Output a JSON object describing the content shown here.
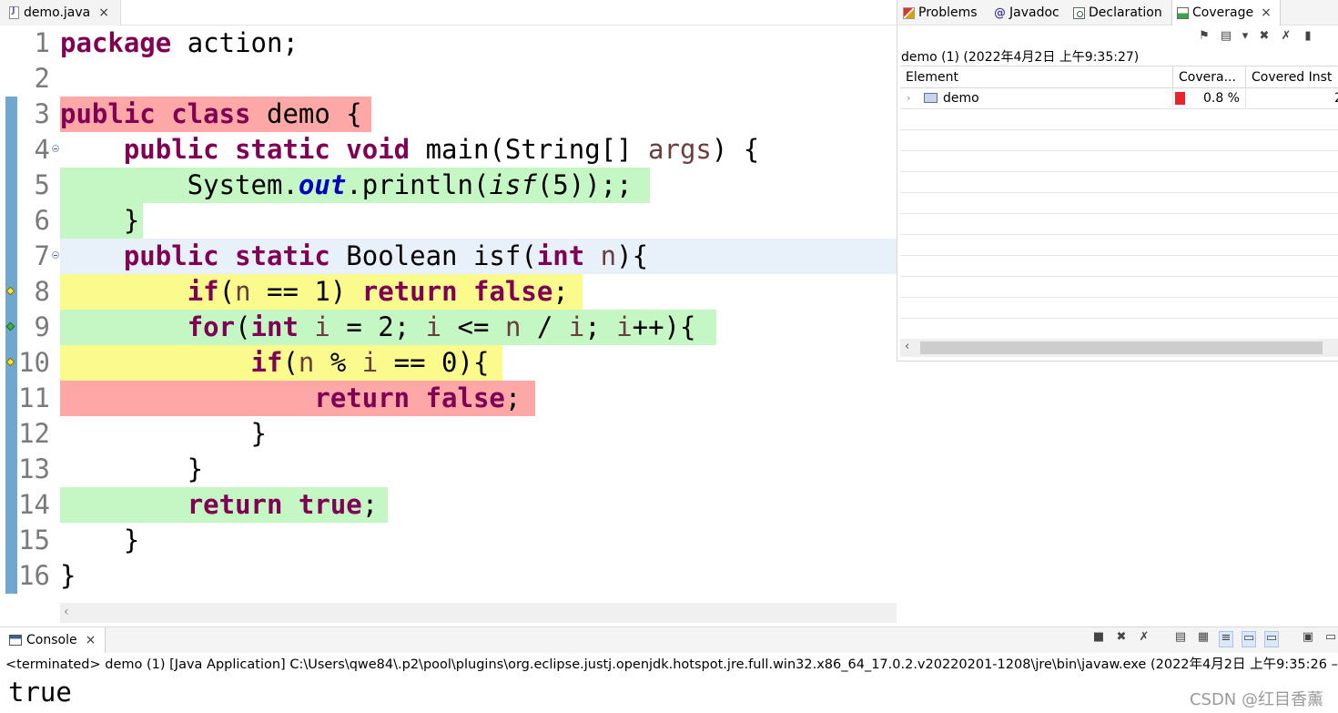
{
  "editor": {
    "tab": {
      "label": "demo.java",
      "close": "×"
    },
    "lines": [
      {
        "n": "1",
        "tokens": [
          [
            "kw",
            "package"
          ],
          [
            "",
            "action;"
          ]
        ]
      },
      {
        "n": "2",
        "tokens": []
      },
      {
        "n": "3",
        "tokens": [
          [
            "kw",
            "public"
          ],
          [
            "kw",
            "class"
          ],
          [
            "",
            "demo {"
          ]
        ]
      },
      {
        "n": "4",
        "tokens": [
          [
            "",
            "    "
          ],
          [
            "kw",
            "public"
          ],
          [
            "kw",
            "static"
          ],
          [
            "kw",
            "void"
          ],
          [
            "",
            "main(String[] "
          ],
          [
            "var",
            "args"
          ],
          [
            "",
            ") {"
          ]
        ]
      },
      {
        "n": "5",
        "tokens": [
          [
            "",
            "        System."
          ],
          [
            "field",
            "out"
          ],
          [
            "",
            ".println("
          ],
          [
            "italic",
            "isf"
          ],
          [
            "",
            "(5));;"
          ]
        ]
      },
      {
        "n": "6",
        "tokens": [
          [
            "",
            "    }"
          ]
        ]
      },
      {
        "n": "7",
        "tokens": [
          [
            "",
            "    "
          ],
          [
            "kw",
            "public"
          ],
          [
            "kw",
            "static"
          ],
          [
            "",
            "Boolean isf("
          ],
          [
            "kw",
            "int"
          ],
          [
            "var",
            "n"
          ],
          [
            "",
            "){"
          ]
        ]
      },
      {
        "n": "8",
        "tokens": [
          [
            "",
            "        "
          ],
          [
            "kw",
            "if"
          ],
          [
            "",
            "("
          ],
          [
            "var",
            "n"
          ],
          [
            "",
            "== 1) "
          ],
          [
            "kw",
            "return"
          ],
          [
            "kw",
            "false"
          ],
          [
            "",
            ";"
          ]
        ]
      },
      {
        "n": "9",
        "tokens": [
          [
            "",
            "        "
          ],
          [
            "kw",
            "for"
          ],
          [
            "",
            "("
          ],
          [
            "kw",
            "int"
          ],
          [
            "var",
            "i"
          ],
          [
            "",
            "= 2; "
          ],
          [
            "var",
            "i"
          ],
          [
            "",
            "<= "
          ],
          [
            "var",
            "n"
          ],
          [
            "",
            "/ "
          ],
          [
            "var",
            "i"
          ],
          [
            "",
            "; "
          ],
          [
            "var",
            "i"
          ],
          [
            "",
            "++){"
          ]
        ]
      },
      {
        "n": "10",
        "tokens": [
          [
            "",
            "            "
          ],
          [
            "kw",
            "if"
          ],
          [
            "",
            "("
          ],
          [
            "var",
            "n"
          ],
          [
            "",
            "% "
          ],
          [
            "var",
            "i"
          ],
          [
            "",
            "== 0){"
          ]
        ]
      },
      {
        "n": "11",
        "tokens": [
          [
            "",
            "                "
          ],
          [
            "kw",
            "return"
          ],
          [
            "kw",
            "false"
          ],
          [
            "",
            ";"
          ]
        ]
      },
      {
        "n": "12",
        "tokens": [
          [
            "",
            "            }"
          ]
        ]
      },
      {
        "n": "13",
        "tokens": [
          [
            "",
            "        }"
          ]
        ]
      },
      {
        "n": "14",
        "tokens": [
          [
            "",
            "        "
          ],
          [
            "kw",
            "return"
          ],
          [
            "kw",
            "true"
          ],
          [
            "",
            ";"
          ]
        ]
      },
      {
        "n": "15",
        "tokens": [
          [
            "",
            "    }"
          ]
        ]
      },
      {
        "n": "16",
        "tokens": [
          [
            "",
            "}"
          ]
        ]
      }
    ]
  },
  "coverage_panel": {
    "tabs": [
      {
        "label": "Problems",
        "icon": "problems-icon"
      },
      {
        "label": "Javadoc",
        "icon": "javadoc-icon"
      },
      {
        "label": "Declaration",
        "icon": "declaration-icon"
      },
      {
        "label": "Coverage",
        "icon": "coverage-icon",
        "active": true,
        "close": "×"
      }
    ],
    "session": "demo (1) (2022年4月2日 上午9:35:27)",
    "columns": [
      "Element",
      "Covera...",
      "Covered Inst"
    ],
    "rows": [
      {
        "chevron": "›",
        "element": "demo",
        "coverage": "0.8 %",
        "covered": "2"
      }
    ],
    "colors": {
      "coverage_bar": "#e9252b"
    }
  },
  "console": {
    "tab_label": "Console",
    "close": "×",
    "status": "<terminated> demo (1) [Java Application] C:\\Users\\qwe84\\.p2\\pool\\plugins\\org.eclipse.justj.openjdk.hotspot.jre.full.win32.x86_64_17.0.2.v20220201-1208\\jre\\bin\\javaw.exe  (2022年4月2日 上午9:35:26 –",
    "output": "true"
  },
  "watermark": "CSDN @红目香薰",
  "colors": {
    "not_covered": "#fda7a7",
    "covered": "#c5f7c5",
    "partial": "#fbfb8d",
    "keyword": "#7f0055",
    "current_line": "#e8f0fa"
  }
}
